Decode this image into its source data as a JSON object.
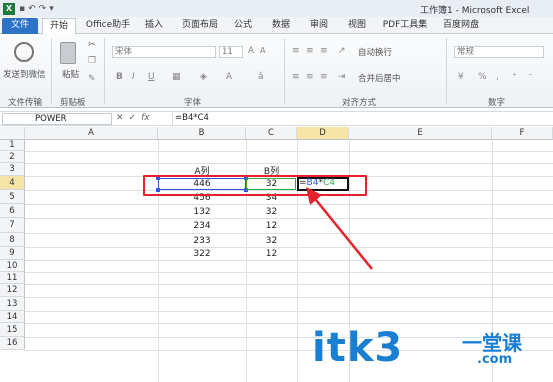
{
  "title_bar": {
    "logo": "X",
    "title": "工作簿1 - Microsoft Excel"
  },
  "tabs": [
    "文件",
    "开始",
    "Office助手",
    "插入",
    "页面布局",
    "公式",
    "数据",
    "审阅",
    "视图",
    "PDF工具集",
    "百度网盘"
  ],
  "ribbon": {
    "wechat_label": "发送到微信",
    "paste_label": "粘贴",
    "font_name": "宋体",
    "font_size": "11",
    "wrap_label": "自动换行",
    "merge_label": "合并后居中",
    "number_format": "常规",
    "percent_symbol": "%",
    "groups": {
      "file_transfer": "文件传输",
      "clipboard": "剪贴板",
      "font": "字体",
      "alignment": "对齐方式",
      "number": "数字"
    }
  },
  "formula_bar": {
    "name_box": "POWER",
    "icons": [
      "✕",
      "✓",
      "fx"
    ],
    "formula": "=B4*C4"
  },
  "columns": [
    "A",
    "B",
    "C",
    "D",
    "E",
    "F"
  ],
  "rows": [
    "1",
    "2",
    "3",
    "4",
    "5",
    "6",
    "7",
    "8",
    "9",
    "10",
    "11",
    "12",
    "13",
    "14",
    "15",
    "16"
  ],
  "cells": {
    "B3": "A列",
    "C3": "B列",
    "B4": "446",
    "C4": "32",
    "B5": "456",
    "C5": "34",
    "B6": "132",
    "C6": "32",
    "B7": "234",
    "C7": "12",
    "B8": "233",
    "C8": "32",
    "B9": "322",
    "C9": "12"
  },
  "editing": {
    "cell": "D4",
    "prefix": "=",
    "ref1": "B4",
    "op": "*",
    "ref2": "C4"
  },
  "colors": {
    "ref1": "#2f5bd7",
    "ref2": "#35a84a",
    "highlight": "#e4242a",
    "file_tab": "#2c72c7"
  },
  "watermark": {
    "main": "itk3",
    "sub": "一堂课",
    "domain": ".com"
  }
}
